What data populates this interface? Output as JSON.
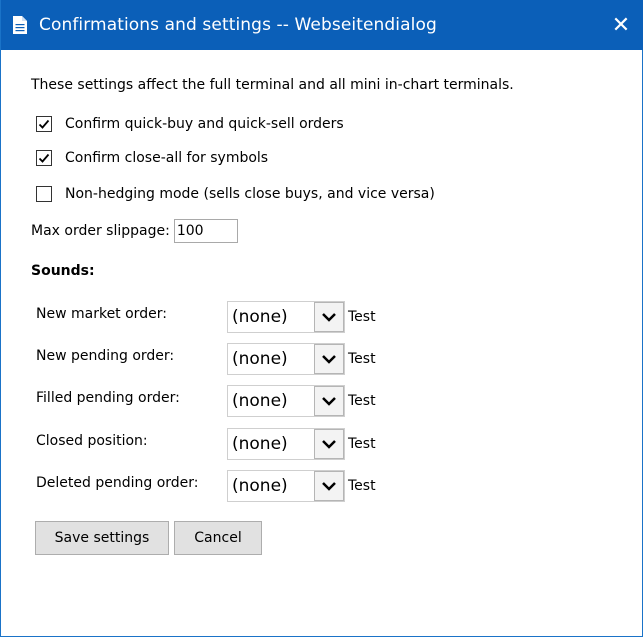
{
  "window": {
    "title": "Confirmations and settings -- Webseitendialog",
    "close_glyph": "✕"
  },
  "description": "These settings affect the full terminal and all mini in-chart terminals.",
  "checkboxes": [
    {
      "label": "Confirm quick-buy and quick-sell orders",
      "checked": true
    },
    {
      "label": "Confirm close-all for symbols",
      "checked": true
    },
    {
      "label": "Non-hedging mode (sells close buys, and vice versa)",
      "checked": false
    }
  ],
  "slippage": {
    "label": "Max order slippage:",
    "value": "100"
  },
  "sounds": {
    "heading": "Sounds:",
    "test_label": "Test",
    "rows": [
      {
        "label": "New market order:",
        "value": "(none)"
      },
      {
        "label": "New pending order:",
        "value": "(none)"
      },
      {
        "label": "Filled pending order:",
        "value": "(none)"
      },
      {
        "label": "Closed position:",
        "value": "(none)"
      },
      {
        "label": "Deleted pending order:",
        "value": "(none)"
      }
    ]
  },
  "buttons": {
    "save": "Save settings",
    "cancel": "Cancel"
  },
  "colors": {
    "titlebar": "#0b5fb8",
    "border": "#1a73c8"
  }
}
